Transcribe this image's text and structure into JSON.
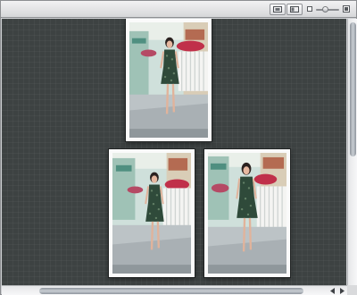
{
  "toolbar": {
    "buttons": [
      {
        "name": "zoom-fit-button",
        "icon": "zoom-fit-icon"
      },
      {
        "name": "view-mode-button",
        "icon": "view-mode-icon"
      }
    ],
    "thumbnail_size": {
      "min_icon": "small-photo-icon",
      "max_icon": "large-photo-icon",
      "level": 0.35
    }
  },
  "canvas": {
    "background": "#3d4242",
    "photos": [
      {
        "name": "photo-thumbnail-top",
        "subject": "woman-walking-patterned-dress"
      },
      {
        "name": "photo-thumbnail-bottom-left",
        "subject": "woman-walking-patterned-dress"
      },
      {
        "name": "photo-thumbnail-bottom-right",
        "subject": "woman-walking-patterned-dress"
      }
    ]
  },
  "scrollbars": {
    "vertical": {
      "position": 0.0
    },
    "horizontal": {
      "position": 0.1
    }
  },
  "colors": {
    "accent_flowers": "#c0304a",
    "building_teal": "#5aa89a",
    "dress": "#2f4a3a"
  }
}
